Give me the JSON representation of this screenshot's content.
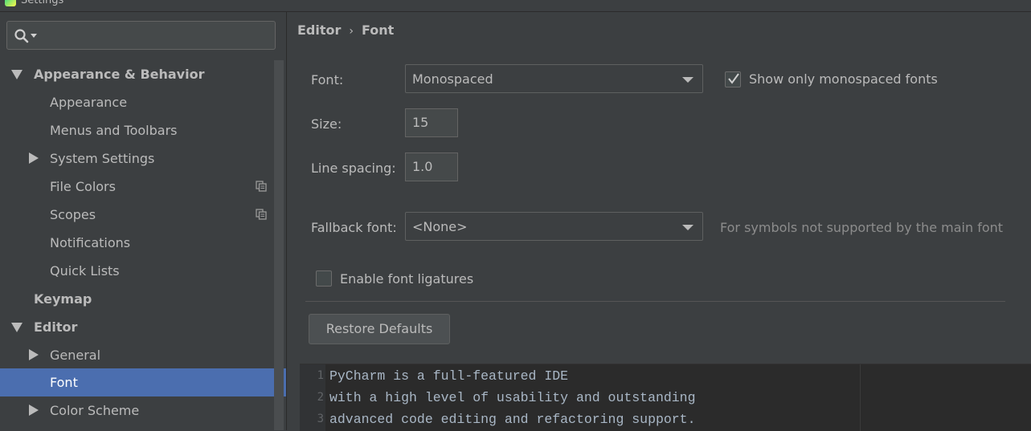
{
  "window": {
    "title": "Settings"
  },
  "search": {
    "placeholder": "",
    "value": ""
  },
  "sidebar": {
    "items": [
      {
        "label": "Appearance & Behavior",
        "level": 0,
        "expanded": true,
        "bold": true
      },
      {
        "label": "Appearance",
        "level": 1
      },
      {
        "label": "Menus and Toolbars",
        "level": 1
      },
      {
        "label": "System Settings",
        "level": 1,
        "collapsed": true
      },
      {
        "label": "File Colors",
        "level": 1,
        "copy_icon": true
      },
      {
        "label": "Scopes",
        "level": 1,
        "copy_icon": true
      },
      {
        "label": "Notifications",
        "level": 1
      },
      {
        "label": "Quick Lists",
        "level": 1
      },
      {
        "label": "Keymap",
        "level": 0,
        "bold": true
      },
      {
        "label": "Editor",
        "level": 0,
        "expanded": true,
        "bold": true
      },
      {
        "label": "General",
        "level": 1,
        "collapsed": true
      },
      {
        "label": "Font",
        "level": 1,
        "selected": true
      },
      {
        "label": "Color Scheme",
        "level": 1,
        "collapsed": true
      }
    ]
  },
  "breadcrumb": {
    "parent": "Editor",
    "separator": "›",
    "current": "Font"
  },
  "font_settings": {
    "font_label": "Font:",
    "font_value": "Monospaced",
    "show_mono_label": "Show only monospaced fonts",
    "show_mono_checked": true,
    "size_label": "Size:",
    "size_value": "15",
    "line_spacing_label": "Line spacing:",
    "line_spacing_value": "1.0",
    "fallback_label": "Fallback font:",
    "fallback_value": "<None>",
    "fallback_hint": "For symbols not supported by the main font",
    "ligatures_label": "Enable font ligatures",
    "ligatures_checked": false,
    "restore_label": "Restore Defaults"
  },
  "preview": {
    "lines": [
      {
        "num": "1",
        "text": "PyCharm is a full-featured IDE"
      },
      {
        "num": "2",
        "text": "with a high level of usability and outstanding"
      },
      {
        "num": "3",
        "text": "advanced code editing and refactoring support."
      }
    ]
  },
  "colors": {
    "background": "#3c3f41",
    "selection": "#4b6eaf",
    "text": "#bbbbbb",
    "editor_bg": "#2b2b2b"
  }
}
